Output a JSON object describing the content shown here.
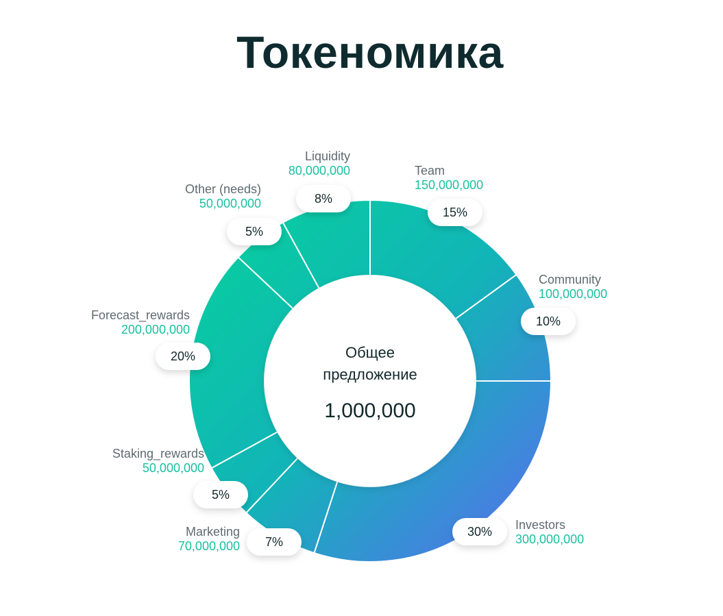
{
  "title": "Токеномика",
  "chart_data": {
    "type": "pie",
    "total_label_line1": "Общее",
    "total_label_line2": "предложение",
    "total_value": "1,000,000",
    "slices": [
      {
        "label": "Team",
        "value_text": "150,000,000",
        "value": 150000000,
        "percent_text": "15%",
        "percent": 15
      },
      {
        "label": "Community",
        "value_text": "100,000,000",
        "value": 100000000,
        "percent_text": "10%",
        "percent": 10
      },
      {
        "label": "Investors",
        "value_text": "300,000,000",
        "value": 300000000,
        "percent_text": "30%",
        "percent": 30
      },
      {
        "label": "Marketing",
        "value_text": "70,000,000",
        "value": 70000000,
        "percent_text": "7%",
        "percent": 7
      },
      {
        "label": "Staking_rewards",
        "value_text": "50,000,000",
        "value": 50000000,
        "percent_text": "5%",
        "percent": 5
      },
      {
        "label": "Forecast_rewards",
        "value_text": "200,000,000",
        "value": 200000000,
        "percent_text": "20%",
        "percent": 20
      },
      {
        "label": "Other (needs)",
        "value_text": "50,000,000",
        "value": 50000000,
        "percent_text": "5%",
        "percent": 5
      },
      {
        "label": "Liquidity",
        "value_text": "80,000,000",
        "value": 80000000,
        "percent_text": "8%",
        "percent": 8
      }
    ],
    "colors": {
      "gradient_start": "#06d19b",
      "gradient_mid": "#12b4b8",
      "gradient_end": "#5a6cf0",
      "label_value": "#19c0a0",
      "label_name": "#5f6b70"
    }
  }
}
